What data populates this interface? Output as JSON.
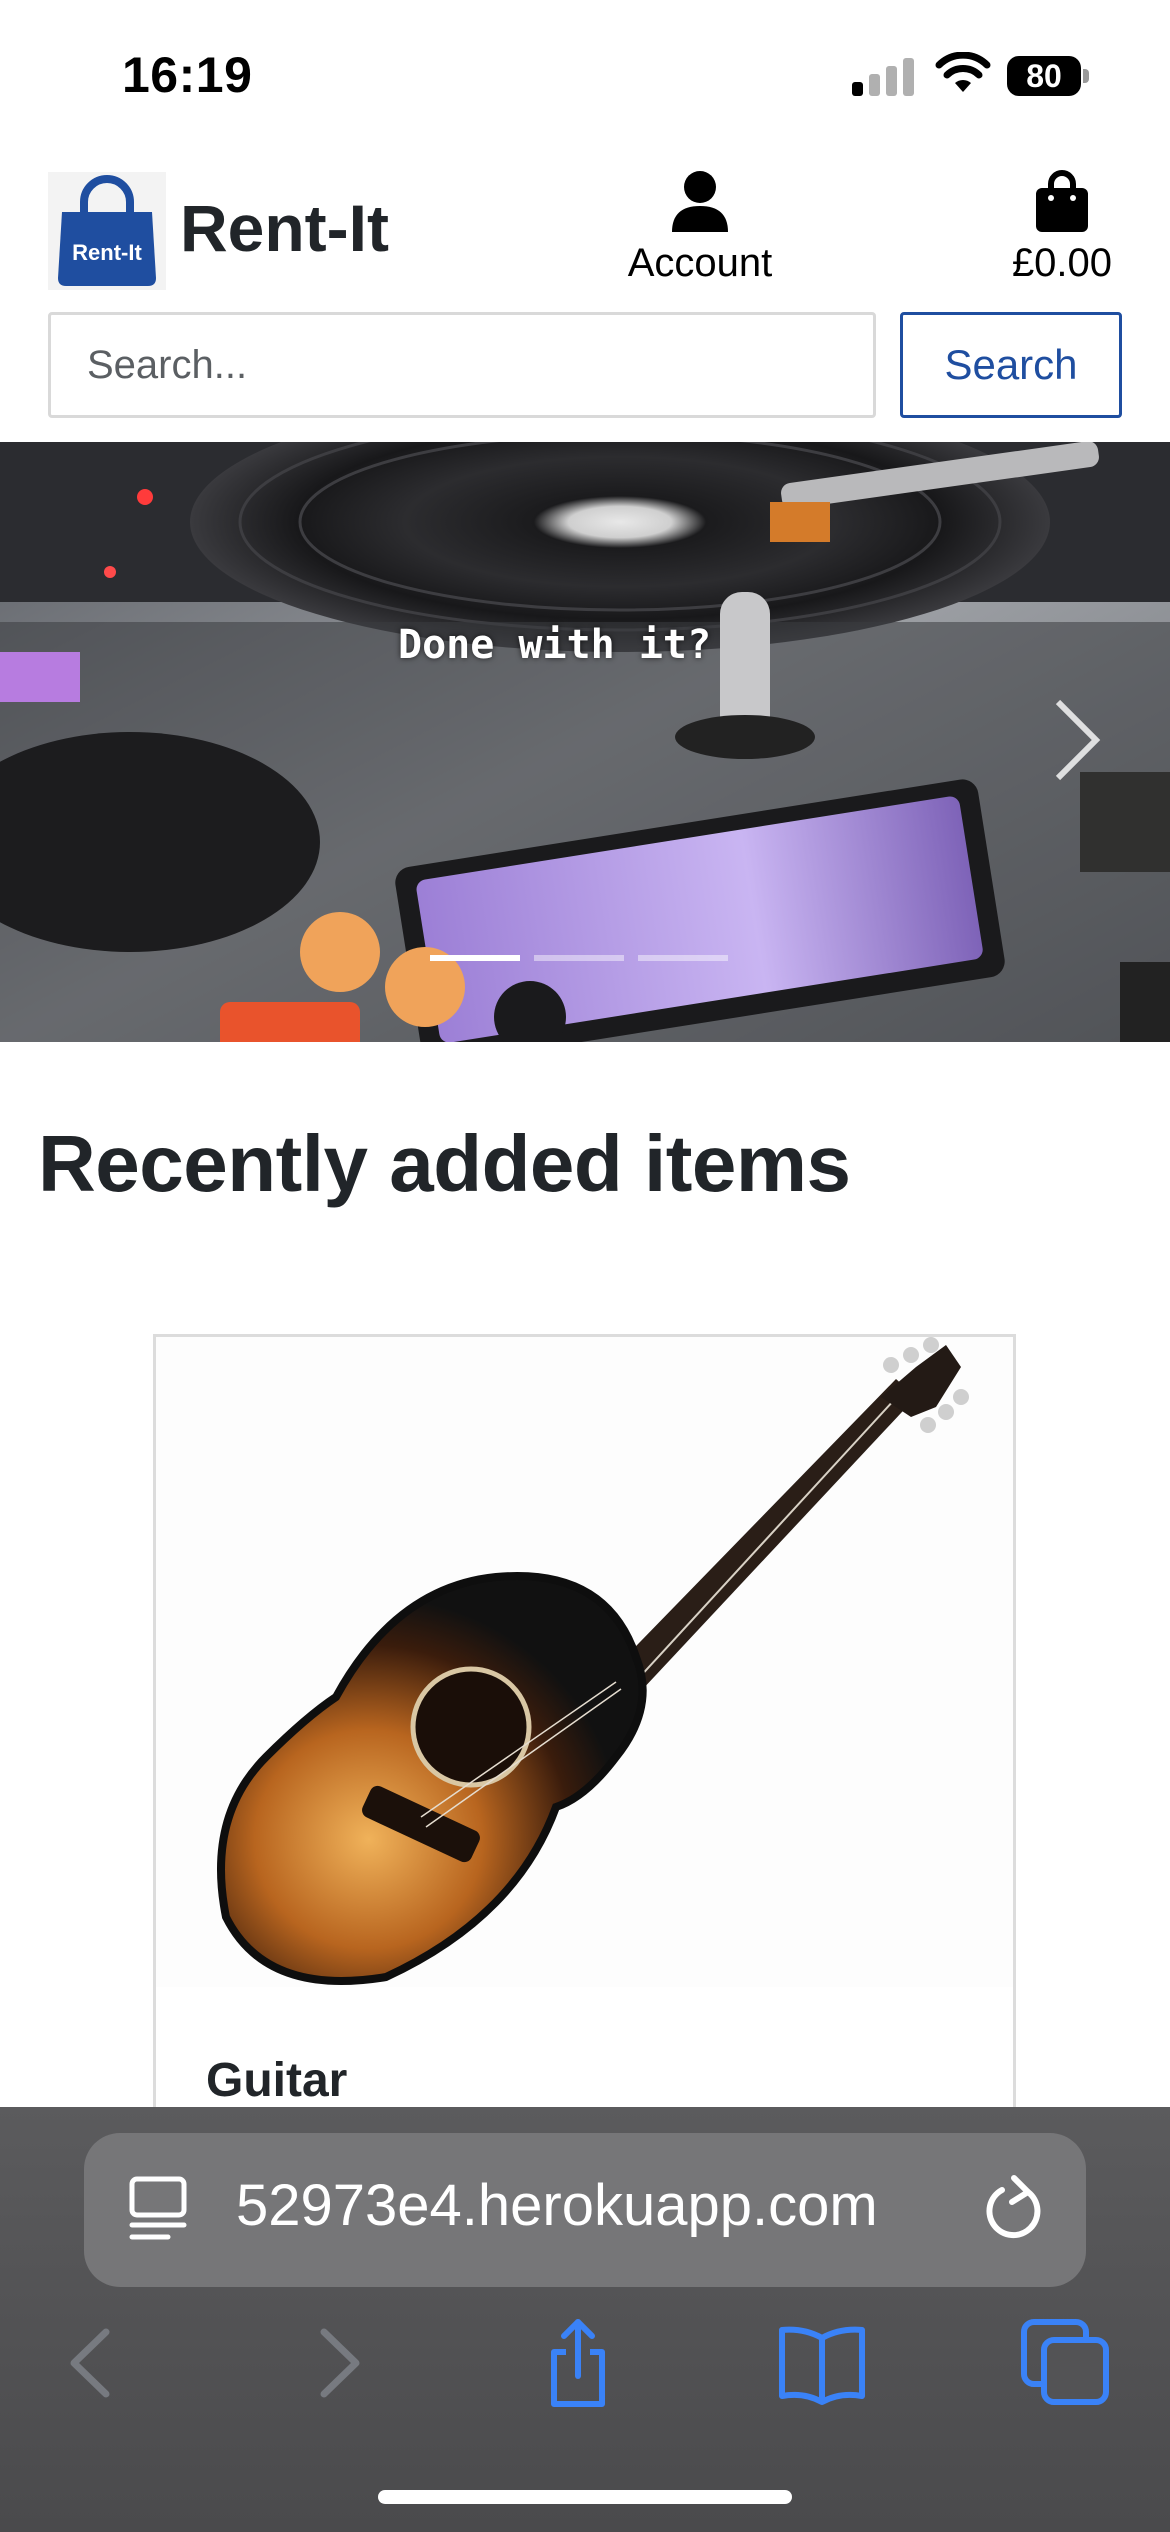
{
  "status_bar": {
    "time": "16:19",
    "battery": "80"
  },
  "header": {
    "brand": "Rent-It",
    "logo_text": "Rent-It",
    "account_label": "Account",
    "cart_total": "£0.00"
  },
  "search": {
    "placeholder": "Search...",
    "button_label": "Search"
  },
  "carousel": {
    "caption": "Done with it?",
    "slide_count": 3,
    "active_index": 0
  },
  "main": {
    "section_title": "Recently added items",
    "items": [
      {
        "title": "Guitar"
      }
    ]
  },
  "browser": {
    "url": "52973e4.herokuapp.com"
  },
  "colors": {
    "brand_blue": "#1f4ea0",
    "text_dark": "#212529",
    "ios_blue": "#3a82f7"
  },
  "icons": [
    "signal-icon",
    "wifi-icon",
    "battery-icon",
    "shopping-bag-icon",
    "user-icon",
    "chevron-right-icon",
    "reader-icon",
    "reload-icon",
    "back-icon",
    "forward-icon",
    "share-icon",
    "bookmarks-icon",
    "tabs-icon"
  ]
}
